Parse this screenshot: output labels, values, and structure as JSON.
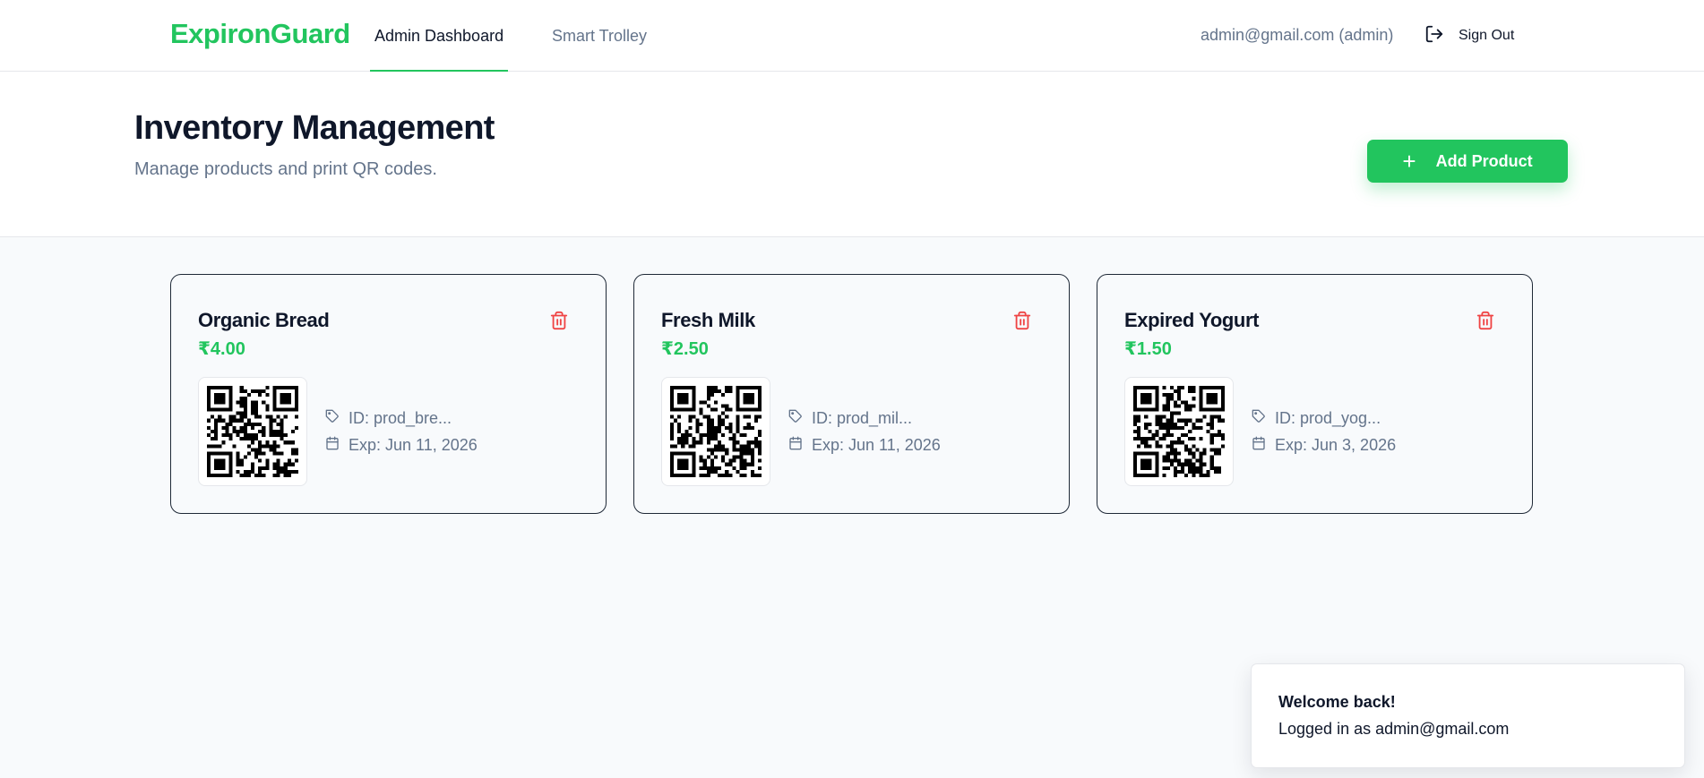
{
  "app": {
    "brand": "ExpironGuard",
    "accent_color": "#22c55e",
    "danger_color": "#ef4444"
  },
  "nav": {
    "tabs": [
      {
        "label": "Admin Dashboard",
        "active": true
      },
      {
        "label": "Smart Trolley",
        "active": false
      }
    ],
    "user_label": "admin@gmail.com (admin)",
    "signout_label": "Sign Out",
    "signout_icon": "log-out-icon"
  },
  "header": {
    "title": "Inventory Management",
    "subtitle": "Manage products and print QR codes.",
    "add_button": {
      "label": "Add Product",
      "icon": "plus-icon"
    }
  },
  "products": [
    {
      "name": "Organic Bread",
      "price": "₹4.00",
      "id_label": "ID: prod_bre...",
      "exp_label": "Exp: Jun 11, 2026",
      "qr_icon": "qr-code-icon",
      "delete_icon": "trash-icon"
    },
    {
      "name": "Fresh Milk",
      "price": "₹2.50",
      "id_label": "ID: prod_mil...",
      "exp_label": "Exp: Jun 11, 2026",
      "qr_icon": "qr-code-icon",
      "delete_icon": "trash-icon"
    },
    {
      "name": "Expired Yogurt",
      "price": "₹1.50",
      "id_label": "ID: prod_yog...",
      "exp_label": "Exp: Jun 3, 2026",
      "qr_icon": "qr-code-icon",
      "delete_icon": "trash-icon"
    }
  ],
  "toast": {
    "title": "Welcome back!",
    "message": "Logged in as admin@gmail.com"
  }
}
